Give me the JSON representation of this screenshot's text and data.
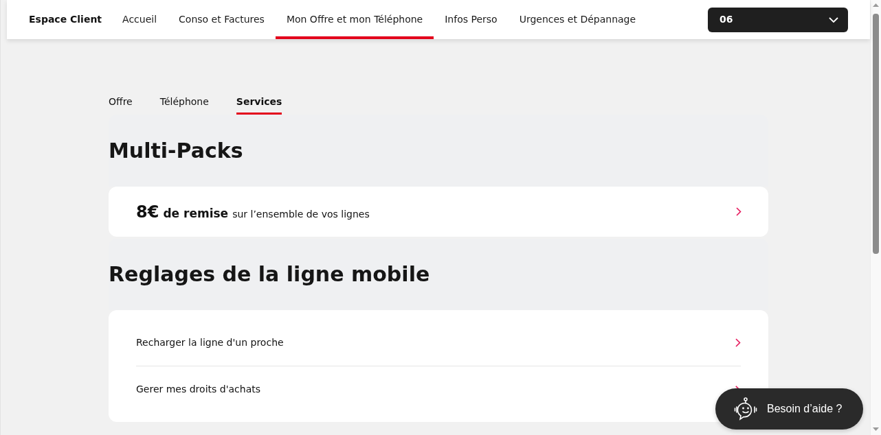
{
  "header": {
    "brand": "Espace Client",
    "nav": [
      {
        "label": "Accueil",
        "selected": false
      },
      {
        "label": "Conso et Factures",
        "selected": false
      },
      {
        "label": "Mon Offre et mon Téléphone",
        "selected": true
      },
      {
        "label": "Infos Perso",
        "selected": false
      },
      {
        "label": "Urgences et Dépannage",
        "selected": false
      }
    ],
    "line_selector": {
      "value": "06"
    }
  },
  "sub_tabs": [
    {
      "label": "Offre",
      "selected": false
    },
    {
      "label": "Téléphone",
      "selected": false
    },
    {
      "label": "Services",
      "selected": true
    }
  ],
  "sections": [
    {
      "title": "Multi-Packs",
      "items": [
        {
          "kind": "promo",
          "amount": "8€",
          "emphasis": "de remise",
          "text": "sur l’ensemble de vos lignes"
        }
      ]
    },
    {
      "title": "Reglages de la ligne mobile",
      "items": [
        {
          "kind": "link",
          "label": "Recharger la ligne d'un proche"
        },
        {
          "kind": "link",
          "label": "Gerer mes droits d'achats"
        }
      ]
    }
  ],
  "help_button": {
    "label": "Besoin d’aide ?"
  }
}
